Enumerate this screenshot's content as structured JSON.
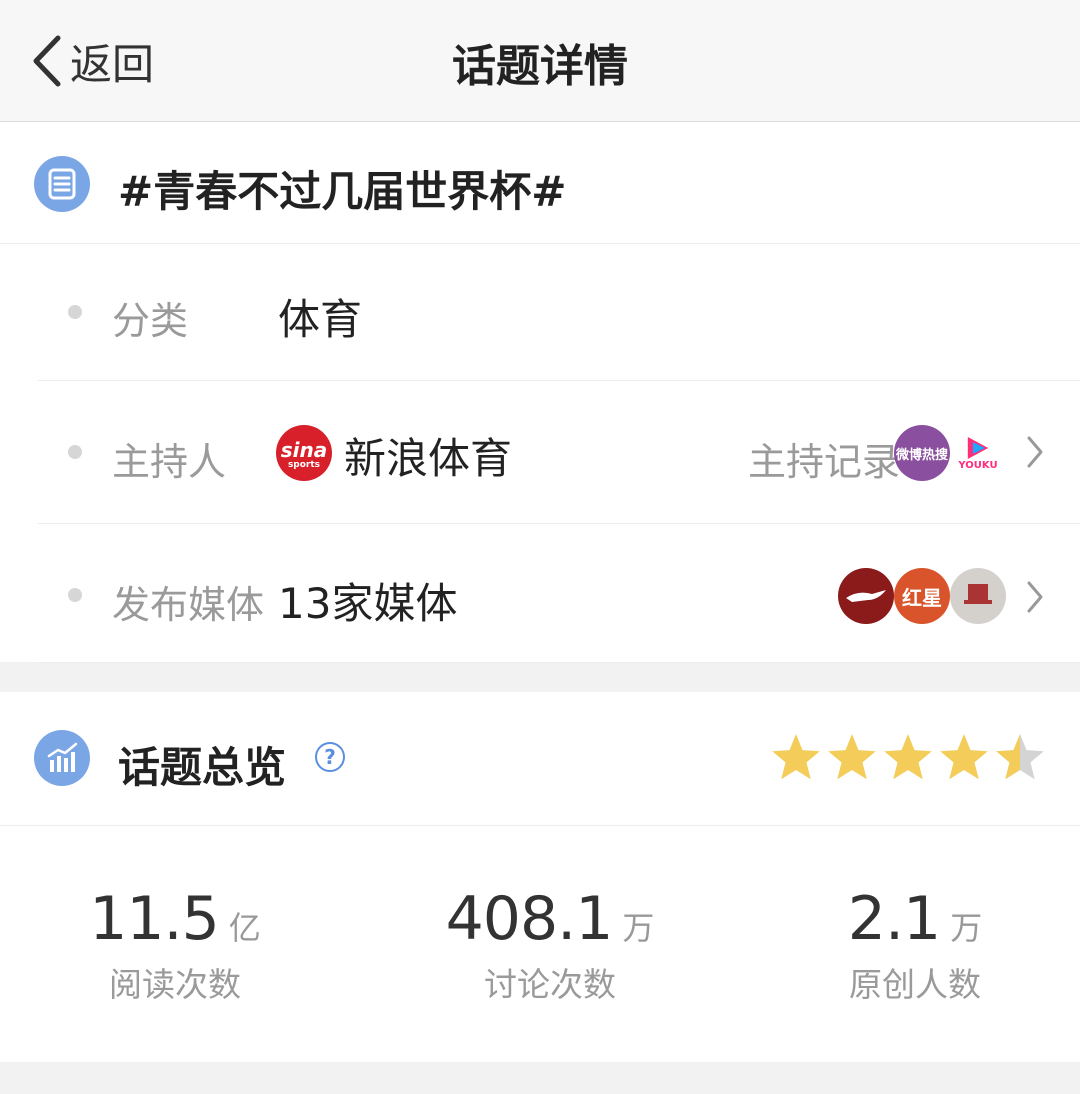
{
  "nav": {
    "back_label": "返回",
    "title": "话题详情"
  },
  "topic": {
    "title": "#青春不过几届世界杯#"
  },
  "rows": {
    "category": {
      "label": "分类",
      "value": "体育"
    },
    "host": {
      "label": "主持人",
      "value": "新浪体育",
      "record_label": "主持记录",
      "host_logo_text": "sina",
      "host_logo_subtext": "sports",
      "record_badge_text": "微博热搜",
      "record_badge2_text": "YOUKU"
    },
    "media": {
      "label": "发布媒体",
      "value": "13家媒体",
      "media_logo2_text": "红星"
    }
  },
  "overview": {
    "title": "话题总览",
    "help_glyph": "?",
    "rating": 4.5,
    "stats": [
      {
        "value": "11.5",
        "unit": "亿",
        "label": "阅读次数"
      },
      {
        "value": "408.1",
        "unit": "万",
        "label": "讨论次数"
      },
      {
        "value": "2.1",
        "unit": "万",
        "label": "原创人数"
      }
    ]
  },
  "colors": {
    "accent_blue": "#7aa6e6",
    "star_gold": "#f4cc5a",
    "star_grey": "#d4d4d4",
    "sina_red": "#d8202a"
  },
  "icons": {
    "back": "chevron-left-icon",
    "topic": "list-document-icon",
    "overview": "bar-chart-icon",
    "help": "question-circle-icon",
    "row_arrow": "chevron-right-icon"
  }
}
